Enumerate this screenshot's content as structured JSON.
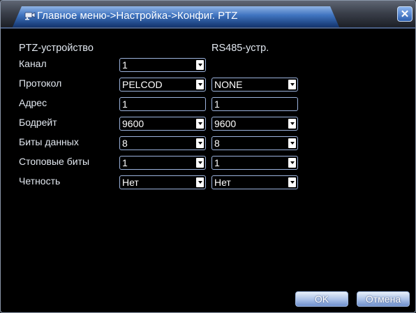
{
  "window": {
    "title": "Главное меню->Настройка->Конфиг. PTZ",
    "close_glyph": "✕"
  },
  "sections": {
    "ptz_header": "PTZ-устройство",
    "rs485_header": "RS485-устр."
  },
  "rows": [
    {
      "label": "Канал",
      "ptz_value": "1",
      "rs485_value": null
    },
    {
      "label": "Протокол",
      "ptz_value": "PELCOD",
      "rs485_value": "NONE"
    },
    {
      "label": "Адрес",
      "ptz_value": "1",
      "rs485_value": "1"
    },
    {
      "label": "Бодрейт",
      "ptz_value": "9600",
      "rs485_value": "9600"
    },
    {
      "label": "Биты данных",
      "ptz_value": "8",
      "rs485_value": "8"
    },
    {
      "label": "Стоповые биты",
      "ptz_value": "1",
      "rs485_value": "1"
    },
    {
      "label": "Четность",
      "ptz_value": "Нет",
      "rs485_value": "Нет"
    }
  ],
  "buttons": {
    "ok": "OK",
    "cancel": "Отмена"
  },
  "colors": {
    "background": "#000000",
    "title_tab": "#3f74c0",
    "field_border": "#9cb3dd",
    "text": "#e2e8f0"
  },
  "icons": {
    "title": "camera-icon",
    "close": "close-icon",
    "dropdown": "chevron-down-icon"
  }
}
